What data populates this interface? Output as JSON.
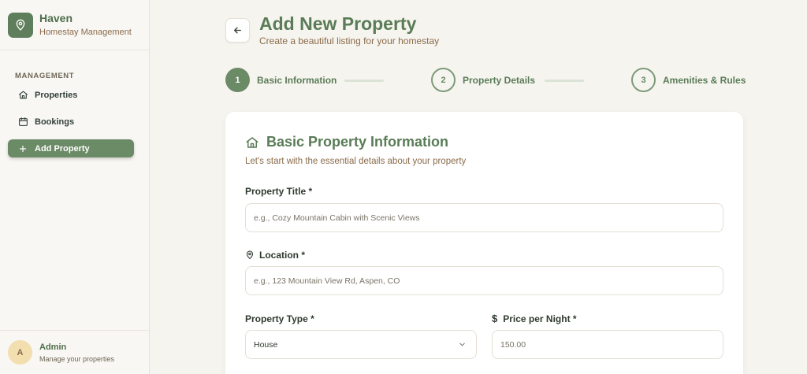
{
  "brand": {
    "title": "Haven",
    "subtitle": "Homestay Management"
  },
  "sidebar": {
    "section_label": "MANAGEMENT",
    "items": [
      {
        "label": "Properties",
        "icon": "home-icon"
      },
      {
        "label": "Bookings",
        "icon": "calendar-icon"
      },
      {
        "label": "Add Property",
        "icon": "plus-icon",
        "active": true
      }
    ]
  },
  "user": {
    "initial": "A",
    "name": "Admin",
    "subtitle": "Manage your properties"
  },
  "header": {
    "title": "Add New Property",
    "subtitle": "Create a beautiful listing for your homestay"
  },
  "steps": [
    {
      "number": "1",
      "label": "Basic Information",
      "status": "current"
    },
    {
      "number": "2",
      "label": "Property Details",
      "status": "upcoming"
    },
    {
      "number": "3",
      "label": "Amenities & Rules",
      "status": "upcoming"
    }
  ],
  "form": {
    "title": "Basic Property Information",
    "subtitle": "Let's start with the essential details about your property",
    "property_title": {
      "label": "Property Title *",
      "placeholder": "e.g., Cozy Mountain Cabin with Scenic Views",
      "value": ""
    },
    "location": {
      "label": "Location *",
      "placeholder": "e.g., 123 Mountain View Rd, Aspen, CO",
      "value": ""
    },
    "property_type": {
      "label": "Property Type *",
      "value": "House"
    },
    "price": {
      "label": "Price per Night *",
      "placeholder": "150.00",
      "value": ""
    }
  },
  "colors": {
    "accent": "#6b8a66",
    "title": "#5a7c57",
    "subtext": "#8a6b4a",
    "background": "#f6f4ef"
  }
}
